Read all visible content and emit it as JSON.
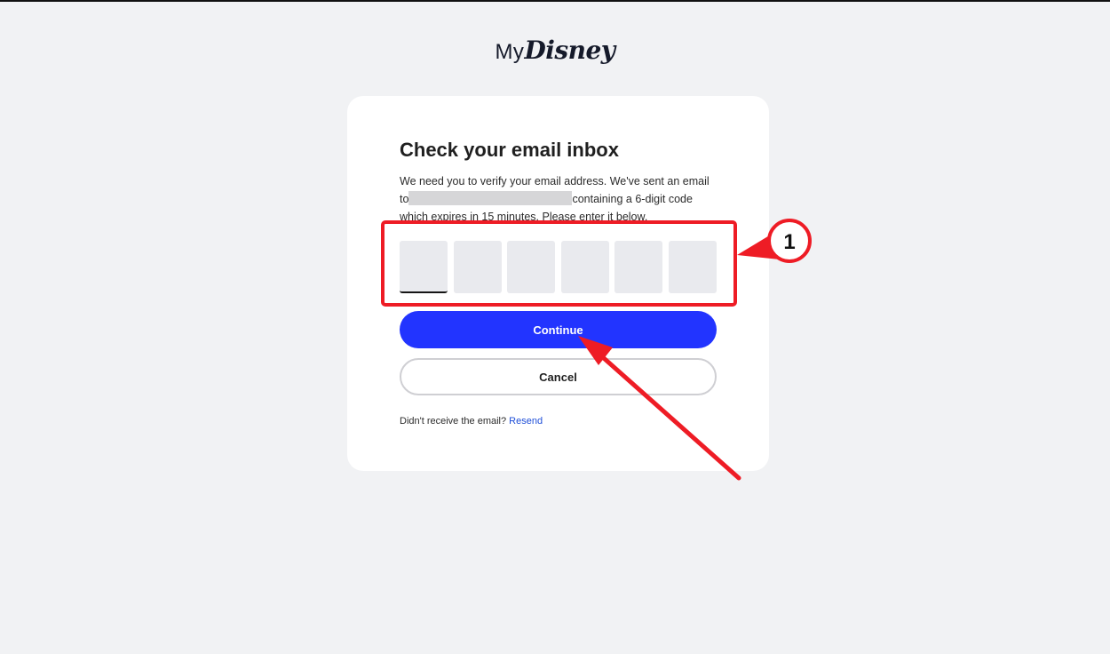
{
  "logo": {
    "prefix": "My",
    "brand": "Disney"
  },
  "verify": {
    "title": "Check your email inbox",
    "description_line1": "We need you to verify your email address. We've sent an email",
    "description_to": "to",
    "description_line2_rest": "containing a 6-digit code",
    "description_line3": "which expires in 15 minutes. Please enter it below.",
    "code_length": 6,
    "continue_label": "Continue",
    "cancel_label": "Cancel",
    "resend_prompt": "Didn't receive the email?",
    "resend_label": "Resend"
  },
  "annotation": {
    "step_number": "1",
    "color": "#ee1c25"
  },
  "colors": {
    "background": "#f1f2f4",
    "card": "#ffffff",
    "primary_button": "#2234ff",
    "link": "#1f4fd8",
    "code_box": "#e9eaee"
  }
}
